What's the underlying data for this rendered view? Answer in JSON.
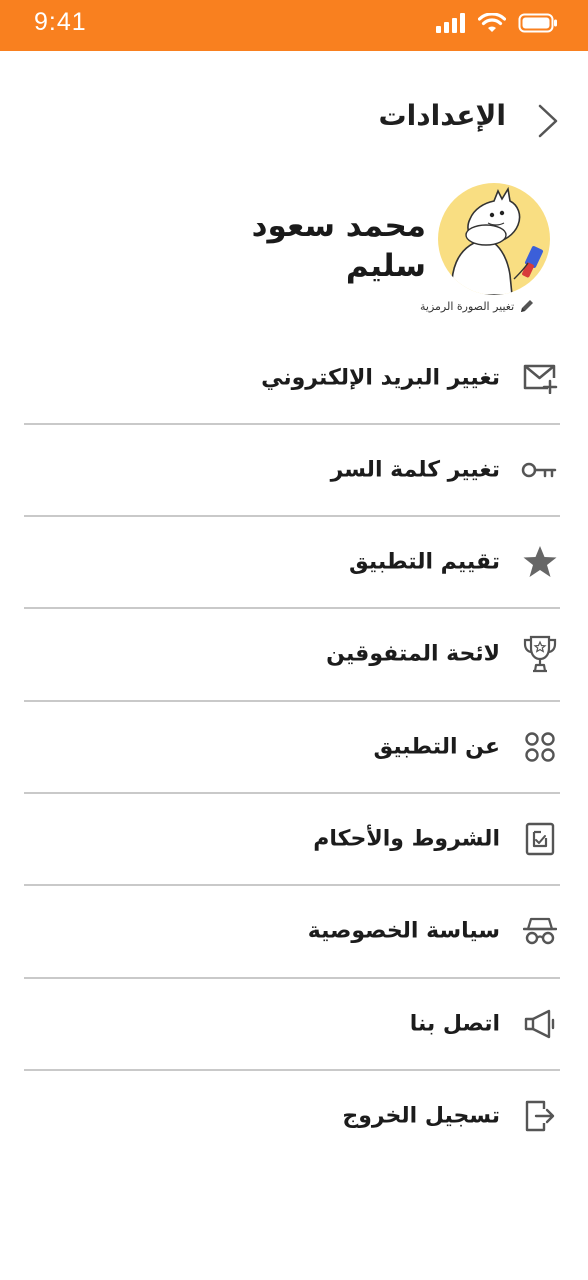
{
  "status_bar": {
    "time": "9:41",
    "background": "#f9801f"
  },
  "header": {
    "title": "الإعدادات",
    "back_icon": "chevron-right-icon"
  },
  "profile": {
    "name": "محمد سعود سليم",
    "change_avatar_label": "تغيير الصورة الرمزية",
    "avatar_bg": "#f9de82"
  },
  "menu": [
    {
      "label": "تغيير البريد الإلكتروني",
      "icon": "mail-plus-icon"
    },
    {
      "label": "تغيير كلمة السر",
      "icon": "key-icon"
    },
    {
      "label": "تقييم التطبيق",
      "icon": "star-icon"
    },
    {
      "label": "لائحة المتفوقين",
      "icon": "trophy-icon"
    },
    {
      "label": "عن التطبيق",
      "icon": "apps-grid-icon"
    },
    {
      "label": "الشروط والأحكام",
      "icon": "document-check-icon"
    },
    {
      "label": "سياسة الخصوصية",
      "icon": "incognito-icon"
    },
    {
      "label": "اتصل بنا",
      "icon": "megaphone-icon"
    },
    {
      "label": "تسجيل الخروج",
      "icon": "logout-icon"
    }
  ]
}
